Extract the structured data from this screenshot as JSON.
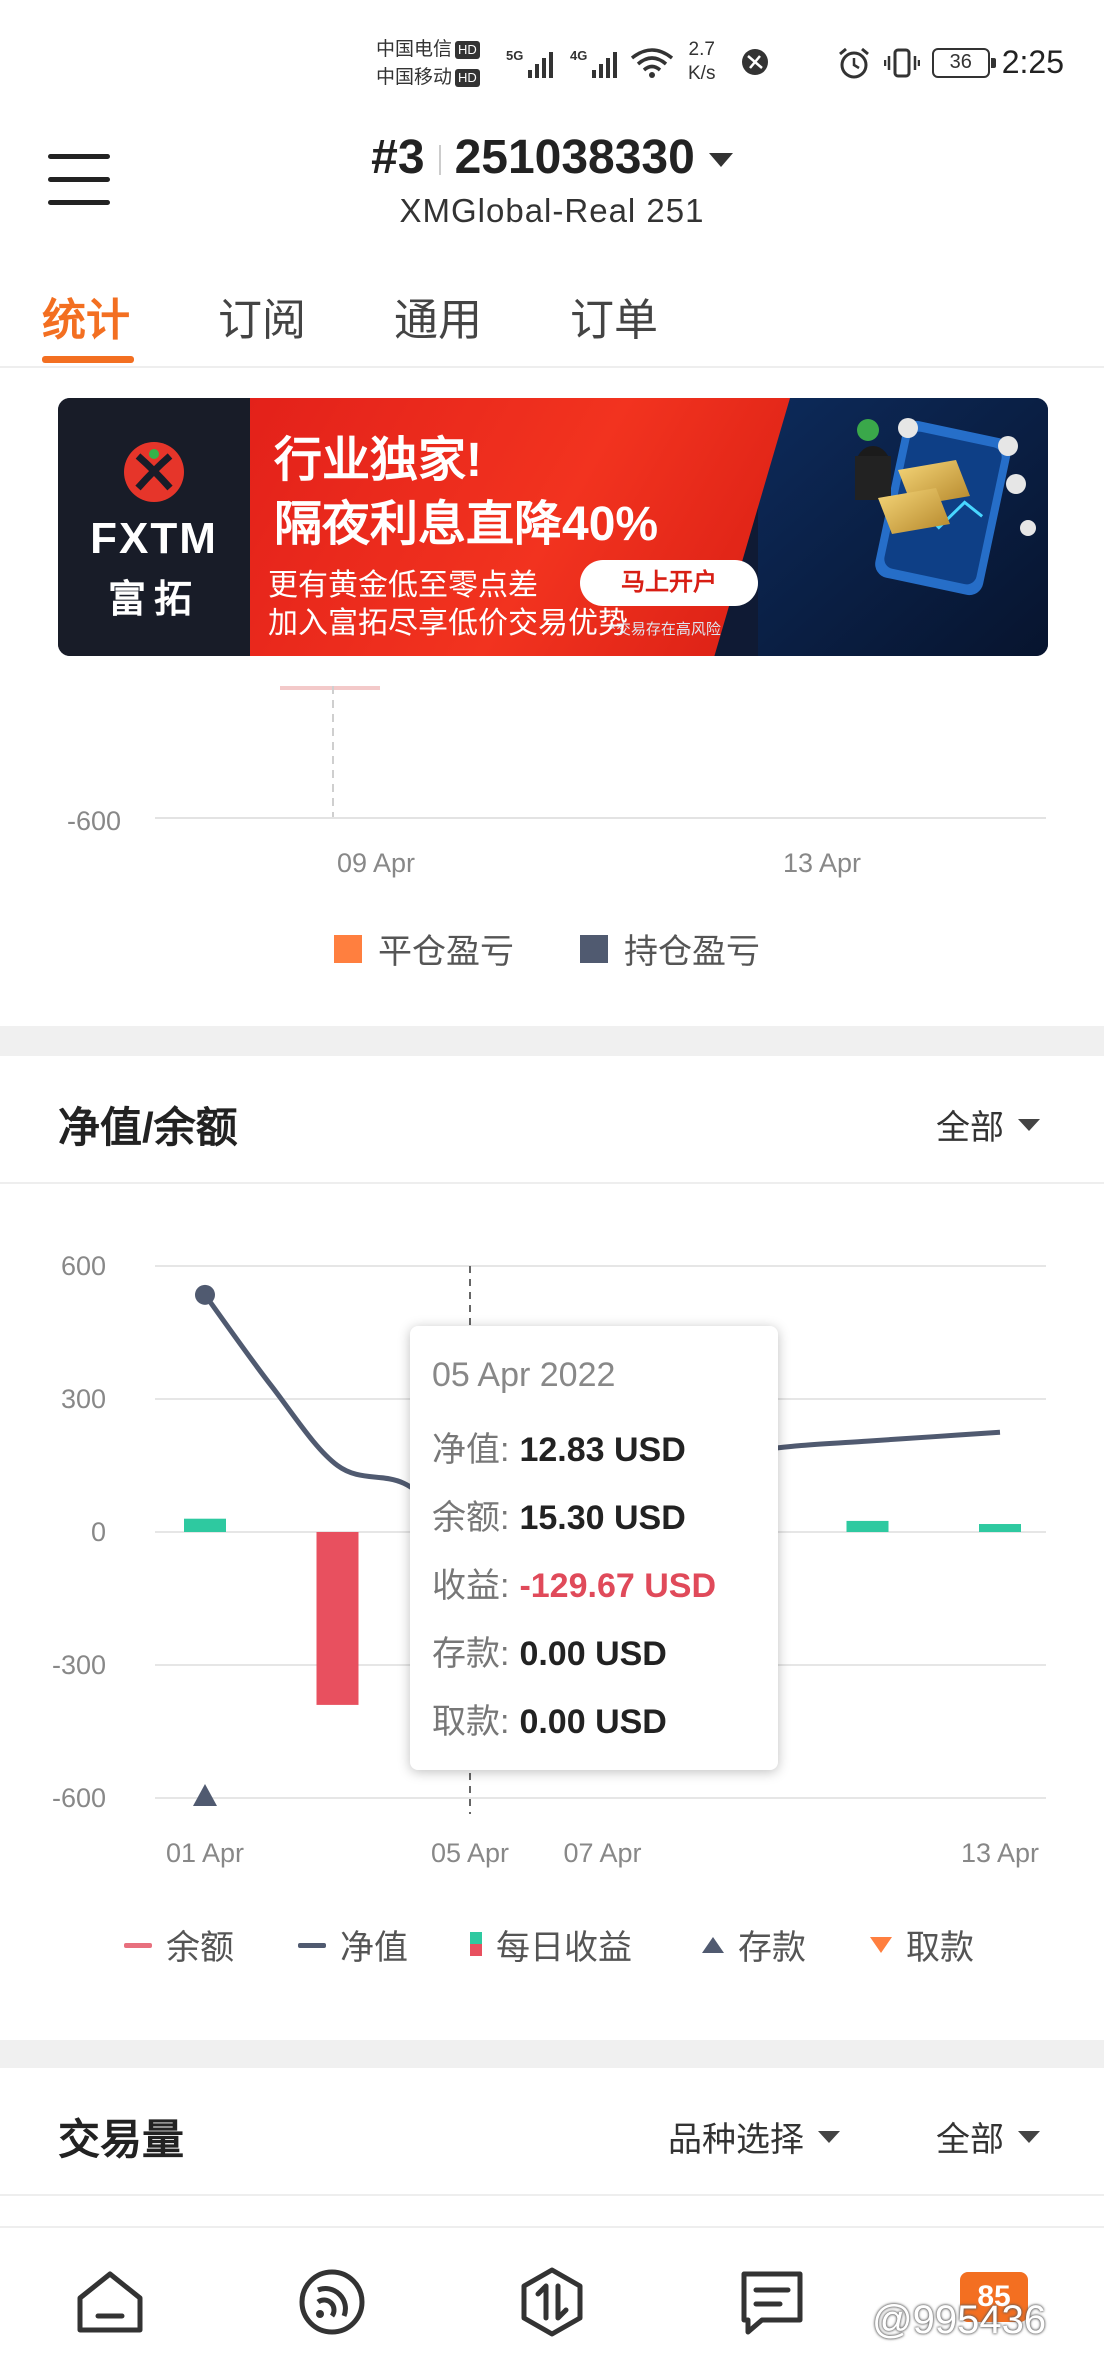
{
  "status_bar": {
    "carrier1": "中国电信",
    "carrier2": "中国移动",
    "hd": "HD",
    "net1": "5G",
    "net2": "4G",
    "speed_value": "2.7",
    "speed_unit": "K/s",
    "battery": "36",
    "time": "2:25"
  },
  "header": {
    "account_index": "#3",
    "account_number": "251038330",
    "server": "XMGlobal-Real 251"
  },
  "tabs": [
    "统计",
    "订阅",
    "通用",
    "订单"
  ],
  "active_tab": 0,
  "banner": {
    "brand": "FXTM",
    "brand_cn": "富拓",
    "headline1": "行业独家!",
    "headline2": "隔夜利息直降40%",
    "sub1": "更有黄金低至零点差",
    "sub2": "加入富拓尽享低价交易优势",
    "cta": "马上开户",
    "risk": "*交易存在高风险",
    "colors": {
      "red": "#e3211a",
      "navy": "#0f1a34"
    }
  },
  "chart_pnl": {
    "y_ticks": [
      "-600"
    ],
    "x_ticks": [
      "09 Apr",
      "13 Apr"
    ],
    "legend": [
      {
        "label": "平仓盈亏",
        "color": "#ff7f3f"
      },
      {
        "label": "持仓盈亏",
        "color": "#505a70"
      }
    ]
  },
  "equity_section": {
    "title": "净值/余额",
    "filter": "全部",
    "tooltip": {
      "date": "05 Apr 2022",
      "rows": [
        {
          "label": "净值:",
          "value": "12.83 USD"
        },
        {
          "label": "余额:",
          "value": "15.30 USD"
        },
        {
          "label": "收益:",
          "value": "-129.67 USD"
        },
        {
          "label": "存款:",
          "value": "0.00 USD"
        },
        {
          "label": "取款:",
          "value": "0.00 USD"
        }
      ]
    },
    "legend": [
      {
        "label": "余额",
        "color": "#e8707e"
      },
      {
        "label": "净值",
        "color": "#505a70"
      },
      {
        "label": "每日收益",
        "color": "#2ec9a0"
      },
      {
        "label": "存款",
        "color": "#505a70"
      },
      {
        "label": "取款",
        "color": "#ff7f3f"
      }
    ]
  },
  "chart_data": {
    "type": "line",
    "title": "净值/余额",
    "y_ticks": [
      600,
      300,
      0,
      -300,
      -600
    ],
    "ylim": [
      -600,
      600
    ],
    "x_ticks": [
      "01 Apr",
      "05 Apr",
      "07 Apr",
      "13 Apr"
    ],
    "x_dates": [
      "01 Apr",
      "02 Apr",
      "03 Apr",
      "04 Apr",
      "05 Apr",
      "06 Apr",
      "07 Apr",
      "08 Apr",
      "09 Apr",
      "10 Apr",
      "11 Apr",
      "12 Apr",
      "13 Apr"
    ],
    "series": [
      {
        "name": "净值",
        "type": "line",
        "color": "#505a70",
        "x": [
          "01 Apr",
          "02 Apr",
          "03 Apr",
          "04 Apr",
          "05 Apr",
          "06 Apr",
          "07 Apr",
          "08 Apr",
          "09 Apr",
          "10 Apr",
          "11 Apr",
          "12 Apr",
          "13 Apr"
        ],
        "values": [
          535,
          330,
          150,
          110,
          13,
          80,
          150,
          172,
          180,
          195,
          205,
          215,
          225
        ]
      },
      {
        "name": "每日收益",
        "type": "bar",
        "positive_color": "#2ec9a0",
        "negative_color": "#e8505f",
        "x": [
          "01 Apr",
          "03 Apr",
          "05 Apr",
          "09 Apr",
          "11 Apr",
          "13 Apr"
        ],
        "values": [
          30,
          -390,
          -130,
          50,
          25,
          18
        ]
      },
      {
        "name": "存款",
        "type": "marker",
        "color": "#505a70",
        "x": [
          "01 Apr"
        ],
        "values": [
          -600
        ]
      }
    ],
    "highlight": "05 Apr"
  },
  "volume_section": {
    "title": "交易量",
    "filter_symbol": "品种选择",
    "filter_range": "全部"
  },
  "bottom_nav": {
    "badge": "85",
    "watermark": "@995436"
  }
}
